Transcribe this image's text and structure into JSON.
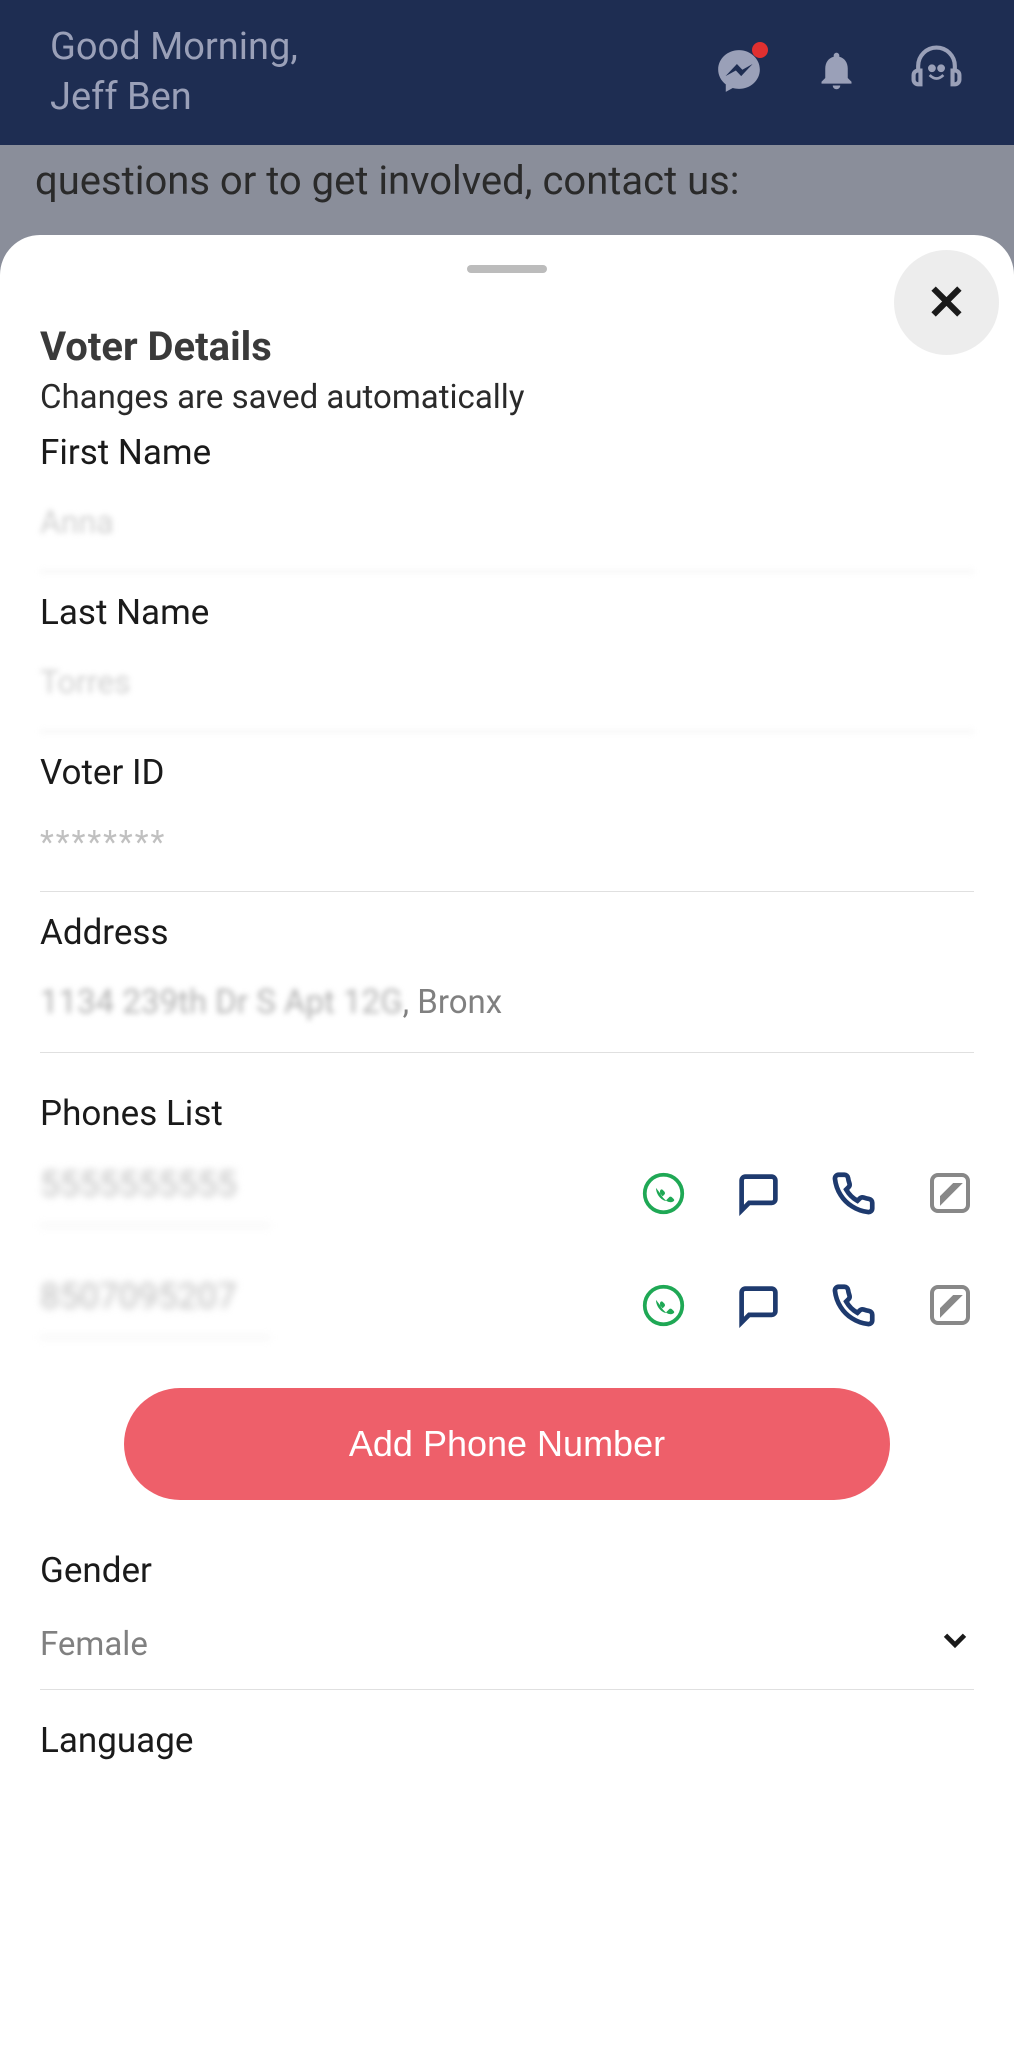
{
  "header": {
    "greeting_line1": "Good Morning,",
    "greeting_line2": "Jeff Ben"
  },
  "background": {
    "text": "questions or to get involved, contact us:"
  },
  "sheet": {
    "title": "Voter Details",
    "subtitle": "Changes are saved automatically",
    "close_label": "✕",
    "fields": {
      "first_name": {
        "label": "First Name",
        "value": "Anna"
      },
      "last_name": {
        "label": "Last Name",
        "value": "Torres"
      },
      "voter_id": {
        "label": "Voter ID",
        "value": "********"
      },
      "address": {
        "label": "Address",
        "blurred_part": "1134 239th Dr S Apt 12G",
        "clear_part": ", Bronx"
      }
    },
    "phones": {
      "label": "Phones List",
      "items": [
        {
          "number": "5555555555"
        },
        {
          "number": "8507095207"
        }
      ],
      "add_button_label": "Add Phone Number"
    },
    "gender": {
      "label": "Gender",
      "value": "Female"
    },
    "language": {
      "label": "Language"
    }
  }
}
